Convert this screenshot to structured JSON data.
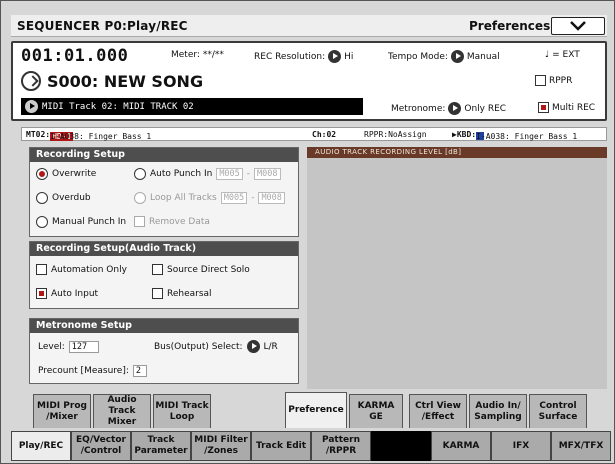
{
  "header": {
    "title": "SEQUENCER P0:Play/REC",
    "preferences_label": "Preferences"
  },
  "location": {
    "position": "001:01.000",
    "meter_label": "Meter:",
    "meter_value": "**/**",
    "rec_resolution_label": "REC Resolution:",
    "rec_resolution_value": "Hi",
    "tempo_mode_label": "Tempo Mode:",
    "tempo_mode_value": "Manual",
    "tempo_value": "♩ = EXT",
    "song_name": "S000: NEW SONG",
    "rppr_label": "RPPR",
    "rppr_checked": false,
    "track_select": "MIDI Track 02: MIDI TRACK 02",
    "metronome_label": "Metronome:",
    "metronome_value": "Only REC",
    "multi_rec_label": "Multi REC",
    "multi_rec_checked": true
  },
  "info_line": {
    "track": "MT02:",
    "hd_badge": "HD-1",
    "program": "I-A038: Finger Bass 1",
    "channel": "Ch:02",
    "rppr": "RPPR:NoAssign",
    "kbd_label": "▶KBD:",
    "kbd_program": "I-A038: Finger Bass 1"
  },
  "recording_setup": {
    "title": "Recording Setup",
    "overwrite": "Overwrite",
    "overdub": "Overdub",
    "manual_punch": "Manual Punch In",
    "auto_punch": "Auto Punch In",
    "auto_punch_from": "M005",
    "auto_punch_to": "M008",
    "loop_all": "Loop All Tracks",
    "loop_from": "M005",
    "loop_to": "M008",
    "remove_data": "Remove Data",
    "range_sep": "-",
    "selected": "overwrite"
  },
  "audio_setup": {
    "title": "Recording Setup(Audio Track)",
    "automation_only": "Automation Only",
    "source_direct_solo": "Source Direct Solo",
    "auto_input": "Auto Input",
    "rehearsal": "Rehearsal",
    "auto_input_checked": true
  },
  "metronome_setup": {
    "title": "Metronome Setup",
    "level_label": "Level:",
    "level_value": "127",
    "bus_label": "Bus(Output) Select:",
    "bus_value": "L/R",
    "precount_label": "Precount [Measure]:",
    "precount_value": "2"
  },
  "audio_level": {
    "title": "AUDIO TRACK RECORDING LEVEL [dB]"
  },
  "upper_tabs": [
    {
      "line1": "MIDI Prog",
      "line2": "/Mixer"
    },
    {
      "line1": "Audio Track",
      "line2": "Mixer"
    },
    {
      "line1": "MIDI Track",
      "line2": "Loop"
    },
    {
      "line1": "Preference",
      "line2": ""
    },
    {
      "line1": "KARMA GE",
      "line2": ""
    },
    {
      "line1": "Ctrl View",
      "line2": "/Effect"
    },
    {
      "line1": "Audio In/",
      "line2": "Sampling"
    },
    {
      "line1": "Control",
      "line2": "Surface"
    }
  ],
  "lower_tabs": [
    {
      "line1": "Play/REC",
      "line2": ""
    },
    {
      "line1": "EQ/Vector",
      "line2": "/Control"
    },
    {
      "line1": "Track",
      "line2": "Parameter"
    },
    {
      "line1": "MIDI Filter",
      "line2": "/Zones"
    },
    {
      "line1": "Track Edit",
      "line2": ""
    },
    {
      "line1": "Pattern",
      "line2": "/RPPR"
    },
    {
      "line1": "",
      "line2": ""
    },
    {
      "line1": "KARMA",
      "line2": ""
    },
    {
      "line1": "IFX",
      "line2": ""
    },
    {
      "line1": "MFX/TFX",
      "line2": ""
    }
  ],
  "colors": {
    "accent_red": "#b01818",
    "panel_title": "#4e4e4e",
    "level_bar": "#6a3a28"
  }
}
